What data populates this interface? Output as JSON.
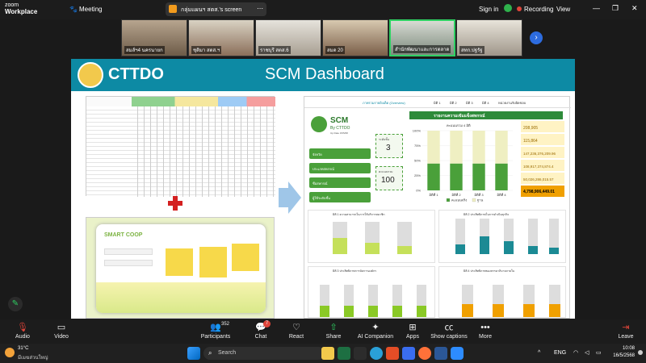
{
  "topbar": {
    "brand_line1": "zoom",
    "brand_line2": "Workplace",
    "meeting_label": "Meeting",
    "share_label": "กลุ่มแผนฯ สตส.'s screen",
    "signin": "Sign in",
    "recording": "Recording",
    "view": "View"
  },
  "participants": [
    {
      "name": "สมส์ฯ4 นครนายก"
    },
    {
      "name": "ชุติมา สตส.ฯ"
    },
    {
      "name": "ราชบุรี สตส.6"
    },
    {
      "name": "สมด 20"
    },
    {
      "name": "สำนักพัฒนาและการตลาด"
    },
    {
      "name": "สทก.ปฐรัฐ"
    }
  ],
  "slide": {
    "logo_text": "CTTDO",
    "title": "SCM Dashboard",
    "dashboard": {
      "tabs": [
        "ภาพรวมรายอิงเด็ด (Overview)",
        "มิติ 1",
        "มิติ 2",
        "มิติ 3",
        "มิติ 4",
        "หน่วยงานรับผิดชอบ"
      ],
      "header": "รายงานความเข้มแข็งสหกรณ์",
      "logo_big": "SCM",
      "logo_by": "By CTTDO",
      "logo_date": "Up Date 15/5/68",
      "filters": [
        "จังหวัด",
        "ประเภทสหกรณ์",
        "ชื่อสหกรณ์",
        "ผู้ใช้ระดับชั้น"
      ],
      "kpi1_label": "ระดับชั้น",
      "kpi1_value": "3",
      "kpi2_label": "คะแนนรวม",
      "kpi2_value": "100",
      "mini_title": "คะแนนรวม 4 มิติ",
      "side_values": [
        "208,905",
        "115,864",
        "147,236,376,209.96",
        "108,917,374,874.4",
        "50,026,286,015.57",
        "4,798,906,449.01"
      ],
      "panels": [
        {
          "title": "มิติ 1 ความสามารถในการให้บริการสมาชิก"
        },
        {
          "title": "มิติ 2 ประสิทธิภาพในการดำเนินธุรกิจ"
        },
        {
          "title": "มิติ 3 ประสิทธิภาพการจัดการองค์กร"
        },
        {
          "title": "มิติ 4 ประสิทธิภาพของธรรมาภิบาลภายใน"
        }
      ]
    }
  },
  "controls": {
    "audio": "Audio",
    "video": "Video",
    "participants": "Participants",
    "participants_count": "352",
    "chat": "Chat",
    "chat_badge": "7",
    "react": "React",
    "share": "Share",
    "ai": "AI Companion",
    "apps": "Apps",
    "captions": "Show captions",
    "more": "More",
    "leave": "Leave"
  },
  "taskbar": {
    "weather_temp": "31°C",
    "weather_desc": "มีเมฆส่วนใหญ่",
    "search_placeholder": "Search",
    "lang": "ENG",
    "time": "10:08",
    "date": "16/5/2568"
  },
  "chart_data": [
    {
      "type": "bar",
      "title": "คะแนนรวม 4 มิติ",
      "categories": [
        "มิติที่ 1",
        "มิติที่ 2",
        "มิติที่ 3",
        "มิติที่ 4"
      ],
      "series": [
        {
          "name": "คะแนนจริง",
          "values": [
            45,
            45,
            45,
            45
          ]
        },
        {
          "name": "ฐาน",
          "values": [
            55,
            55,
            55,
            55
          ]
        }
      ],
      "ylim": [
        0,
        100
      ],
      "legend": "bottom"
    }
  ],
  "colors": {
    "accent": "#0d8aa4",
    "dash_green": "#4aa03a",
    "dash_teal": "#1b8a94",
    "dash_yellow": "#f0a000"
  }
}
